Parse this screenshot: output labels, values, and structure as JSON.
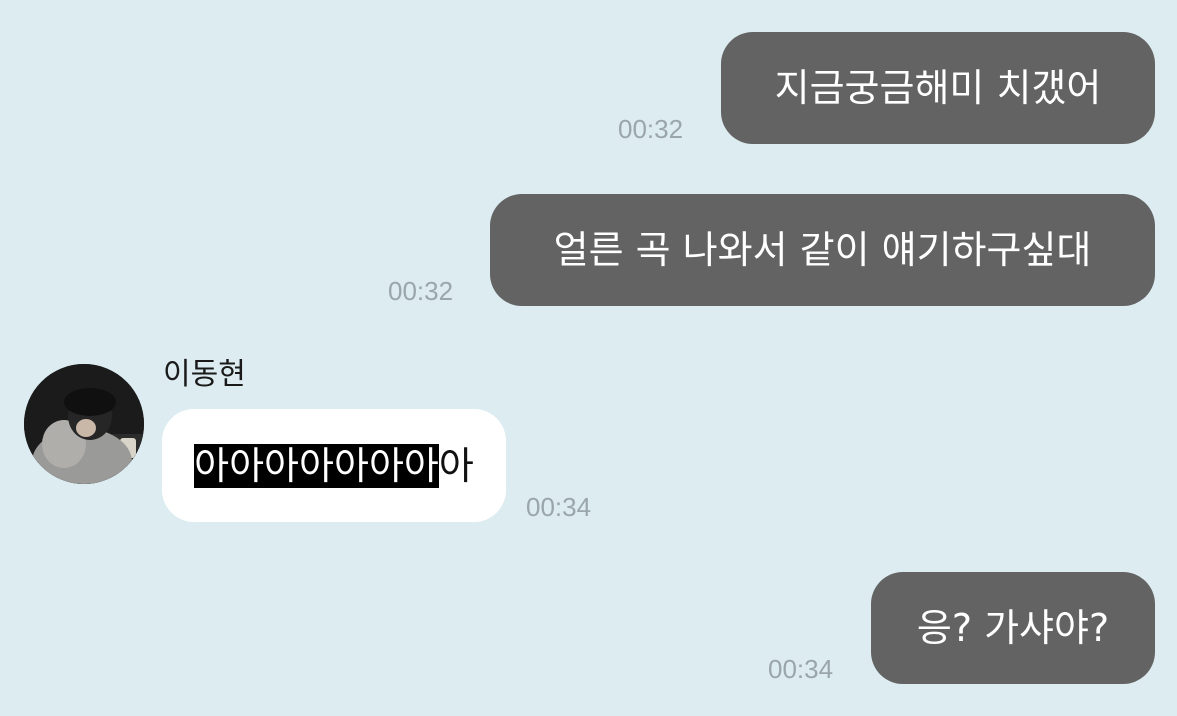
{
  "conversation": {
    "messages": [
      {
        "direction": "sent",
        "text": "지금궁금해미 치갰어",
        "time": "00:32"
      },
      {
        "direction": "sent",
        "text": "얼른 곡 나와서 같이 얘기하구싶대",
        "time": "00:32"
      },
      {
        "direction": "received",
        "sender": "이동현",
        "text_highlighted": "아아아아아아아",
        "text_rest": "아",
        "time": "00:34"
      },
      {
        "direction": "sent",
        "text": "응? 가샤야?",
        "time": "00:34"
      }
    ]
  },
  "colors": {
    "background": "#dcecf1",
    "sent_bubble": "#636363",
    "received_bubble": "#ffffff",
    "timestamp": "#9aa6ab",
    "highlight": "#000000"
  }
}
